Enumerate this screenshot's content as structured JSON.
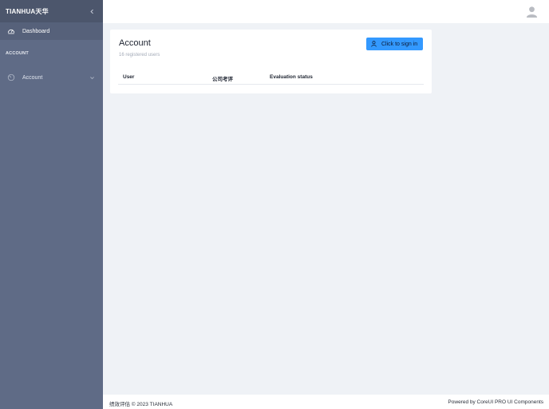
{
  "sidebar": {
    "brand": "TIANHUA天华",
    "collapse_icon": "chevron-left-icon",
    "dashboard_label": "Dashboard",
    "section_title": "ACCOUNT",
    "account_label": "Account"
  },
  "header": {
    "avatar_icon": "user-avatar-icon"
  },
  "card": {
    "title": "Account",
    "subtitle": "16 registered users",
    "signin_label": "Click to sign in",
    "columns": [
      "User",
      "公司考评",
      "Evaluation status"
    ]
  },
  "footer": {
    "left": "绩效评估 © 2023 TIANHUA",
    "right": "Powered by CoreUI PRO UI Components"
  },
  "colors": {
    "sidebar": "#5f6b86",
    "brand_bar": "#4c566c",
    "primary_button": "#3399ff",
    "page_bg": "#eff2f6"
  }
}
